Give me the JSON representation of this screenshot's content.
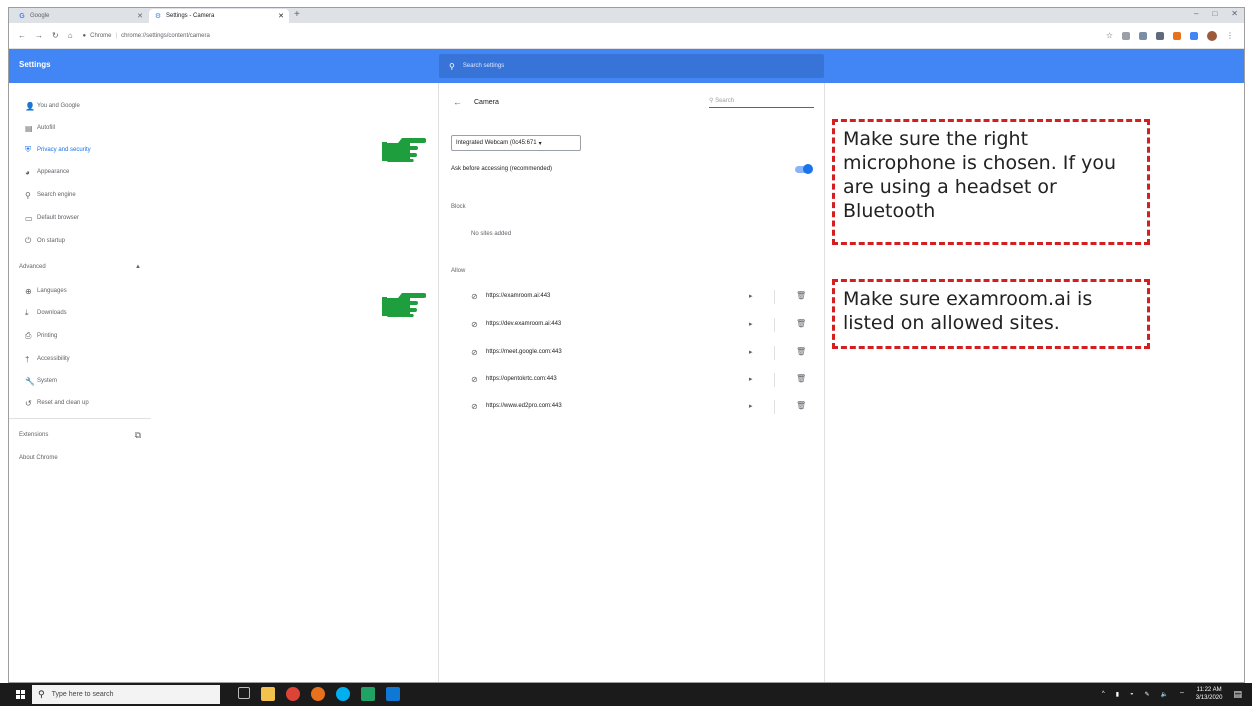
{
  "browser": {
    "tabs": [
      {
        "label": "Google",
        "favicon": "google-g-icon"
      },
      {
        "label": "Settings - Camera",
        "favicon": "settings-gear-icon"
      }
    ],
    "address": {
      "site": "Chrome",
      "path": "chrome://settings/content/camera"
    },
    "window_controls": [
      "–",
      "□",
      "✕"
    ]
  },
  "settings": {
    "title": "Settings",
    "search_placeholder": "Search settings"
  },
  "sidebar": {
    "items": [
      {
        "label": "You and Google",
        "icon": "person-icon"
      },
      {
        "label": "Autofill",
        "icon": "clipboard-icon"
      },
      {
        "label": "Privacy and security",
        "icon": "shield-icon"
      },
      {
        "label": "Appearance",
        "icon": "palette-icon"
      },
      {
        "label": "Search engine",
        "icon": "search-icon"
      },
      {
        "label": "Default browser",
        "icon": "browser-window-icon"
      },
      {
        "label": "On startup",
        "icon": "power-icon"
      }
    ],
    "advanced_label": "Advanced",
    "advanced_items": [
      {
        "label": "Languages",
        "icon": "globe-icon"
      },
      {
        "label": "Downloads",
        "icon": "download-icon"
      },
      {
        "label": "Printing",
        "icon": "printer-icon"
      },
      {
        "label": "Accessibility",
        "icon": "accessibility-icon"
      },
      {
        "label": "System",
        "icon": "wrench-icon"
      },
      {
        "label": "Reset and clean up",
        "icon": "restore-icon"
      }
    ],
    "extensions_label": "Extensions",
    "about_label": "About Chrome"
  },
  "camera": {
    "title": "Camera",
    "search_placeholder": "Search",
    "selected_device": "Integrated Webcam (0c45:671",
    "ask_label": "Ask before accessing (recommended)",
    "ask_enabled": true,
    "block_label": "Block",
    "block_empty": "No sites added",
    "allow_label": "Allow",
    "allowed_sites": [
      "https://examroom.ai:443",
      "https://dev.examroom.ai:443",
      "https://meet.google.com:443",
      "https://opentokrtc.com:443",
      "https://www.ed2pro.com:443"
    ]
  },
  "callouts": {
    "first": "Make sure the right microphone is chosen. If you are using a headset or Bluetooth",
    "second": "Make sure examroom.ai is listed on allowed sites."
  },
  "taskbar": {
    "search_placeholder": "Type here to search",
    "time": "11:22 AM",
    "date": "3/13/2020"
  },
  "colors": {
    "header_blue": "#4285f4",
    "active_blue": "#1a73e8",
    "callout_red": "#d31f1f",
    "hand_green": "#1e9e3c"
  }
}
